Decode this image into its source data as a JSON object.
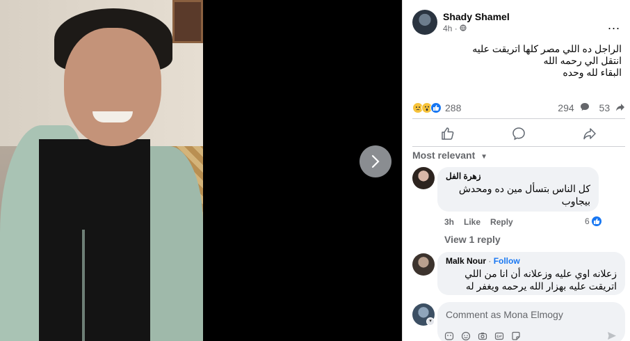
{
  "post": {
    "author": "Shady Shamel",
    "time": "4h",
    "privacy_icon": "globe-icon",
    "more_label": "...",
    "lines": [
      "الراجل ده اللي مصر كلها اتريقت عليه",
      "انتقل الي رحمه الله",
      "البقاء لله وحده"
    ]
  },
  "stats": {
    "reactions_count": "288",
    "comments_count": "294",
    "shares_count": "53",
    "reaction_icons": [
      "sad-reaction-icon",
      "wow-reaction-icon",
      "like-reaction-icon"
    ]
  },
  "actions": {
    "icons": [
      "like-icon",
      "comment-icon",
      "share-icon"
    ]
  },
  "sort": {
    "label": "Most relevant"
  },
  "comments": [
    {
      "author": "زهرة الفل",
      "text": "كل الناس بتسأل مين ده ومحدش بيجاوب",
      "time": "3h",
      "like_label": "Like",
      "reply_label": "Reply",
      "likes": "6",
      "view_replies": "View 1 reply"
    },
    {
      "author": "Malk Nour",
      "follow_label": "Follow",
      "separator": " · ",
      "text": "زعلانه اوي عليه وزعلانه أن انا من اللي اتريقت عليه بهزار الله يرحمه ويغفر له"
    }
  ],
  "composer": {
    "placeholder": "Comment as Mona Elmogy"
  },
  "colors": {
    "accent": "#1877f2",
    "nav_button": "#8a8d91",
    "bubble": "#f0f2f5",
    "secondary_text": "#65676b"
  }
}
